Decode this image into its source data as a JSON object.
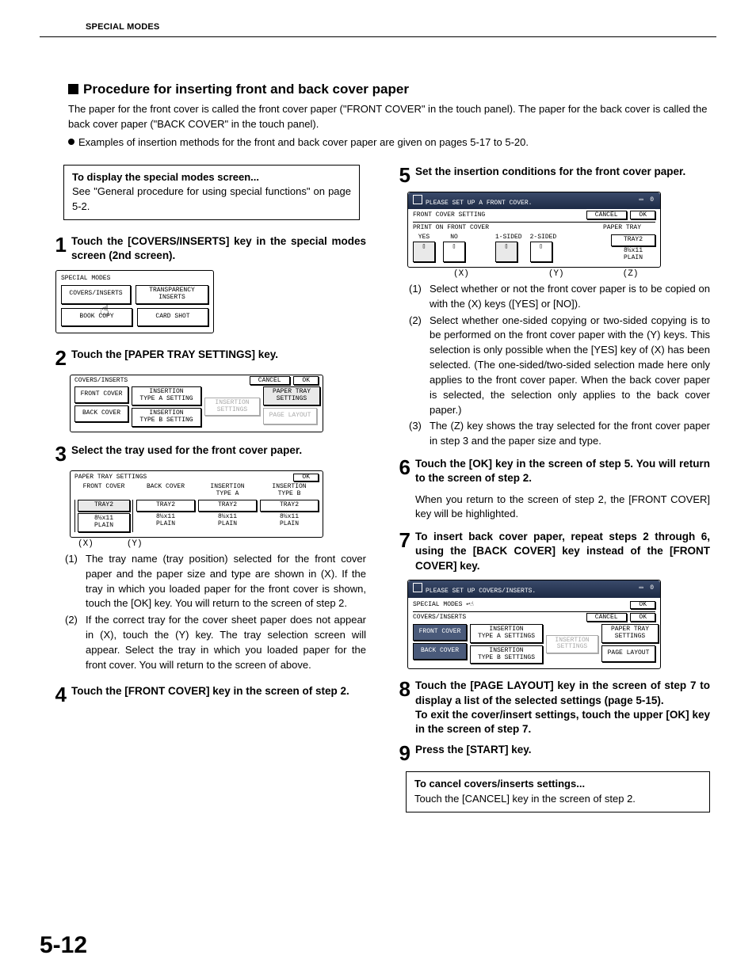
{
  "header": "SPECIAL MODES",
  "page_number": "5-12",
  "section_title": "Procedure for inserting front and back cover paper",
  "intro_p1": "The paper for the front cover is called the front cover paper (\"FRONT COVER\" in the touch panel). The paper for the back cover is called the back cover paper (\"BACK COVER\" in the touch panel).",
  "intro_bullet": "Examples of insertion methods for the front and back cover paper are given on pages 5-17 to 5-20.",
  "note1_title": "To display the special modes screen...",
  "note1_body": "See \"General procedure for using special functions\" on page 5-2.",
  "steps": {
    "s1": "Touch the [COVERS/INSERTS] key in the special modes screen (2nd screen).",
    "s2": "Touch the [PAPER TRAY SETTINGS] key.",
    "s3": "Select the tray used for the front cover paper.",
    "s4": "Touch the [FRONT COVER] key in the screen of step 2.",
    "s5": "Set the insertion conditions for the front cover paper.",
    "s6": "Touch the [OK] key in the screen of step 5. You will return to the screen of step 2.",
    "s7": "To insert back cover paper, repeat steps 2 through 6, using the [BACK COVER] key instead of the [FRONT COVER] key.",
    "s8": "Touch the [PAGE LAYOUT] key in the screen of step 7 to display a list of the selected settings (page 5-15).\nTo exit the cover/insert settings, touch the upper [OK] key in the screen of step 7.",
    "s9": "Press the [START] key."
  },
  "s3_p1": "The tray name (tray position) selected for the front cover paper and the paper size and type are shown in  (X).  If the tray in which  you loaded paper for the front cover is shown, touch the [OK] key. You will return to the screen of step 2.",
  "s3_p2": "If the correct tray for the cover sheet paper does not appear in  (X), touch the (Y) key. The tray selection screen will appear. Select the tray in which you loaded paper for the front cover. You will return to the screen of above.",
  "s5_p1": "Select whether or not the front cover paper is to be copied on with the (X) keys ([YES] or [NO]).",
  "s5_p2": "Select whether one-sided copying or two-sided copying is to be performed on the front cover paper with the (Y) keys. This selection is only possible when the [YES] key of (X) has been selected. (The one-sided/two-sided selection made here only applies to the front cover paper. When the back cover paper is selected, the selection only applies to the back cover paper.)",
  "s5_p3": "The (Z) key shows the tray selected for the front cover paper in step 3 and the paper size and type.",
  "s6_body": "When you return to the screen of step 2, the [FRONT COVER] key will be highlighted.",
  "cancel_title": "To cancel covers/inserts settings...",
  "cancel_body": "Touch the [CANCEL] key in the screen of step 2.",
  "mock1": {
    "title": "SPECIAL MODES",
    "b1": "COVERS/INSERTS",
    "b2": "TRANSPARENCY\nINSERTS",
    "b3": "BOOK COPY",
    "b4": "CARD SHOT"
  },
  "mock2": {
    "title": "COVERS/INSERTS",
    "cancel": "CANCEL",
    "ok": "OK",
    "front": "FRONT COVER",
    "back": "BACK COVER",
    "ia": "INSERTION\nTYPE A SETTING",
    "ib": "INSERTION\nTYPE B SETTING",
    "ins": "INSERTION\nSETTINGS",
    "pts": "PAPER TRAY\nSETTINGS",
    "pl": "PAGE LAYOUT"
  },
  "mock3": {
    "title": "PAPER TRAY SETTINGS",
    "ok": "OK",
    "cols": [
      "FRONT COVER",
      "BACK COVER",
      "INSERTION\nTYPE A",
      "INSERTION\nTYPE B"
    ],
    "tray": "TRAY2",
    "paper": "8½x11\nPLAIN",
    "x": "(X)",
    "y": "(Y)"
  },
  "mock5": {
    "bar": "PLEASE SET UP A FRONT COVER.",
    "sub": "FRONT COVER SETTING",
    "cancel": "CANCEL",
    "ok": "OK",
    "print": "PRINT ON FRONT COVER",
    "pt": "PAPER TRAY",
    "yes": "YES",
    "no": "NO",
    "s1": "1-SIDED",
    "s2": "2-SIDED",
    "tray": "TRAY2",
    "paper": "8½x11\nPLAIN",
    "x": "(X)",
    "y": "(Y)",
    "z": "(Z)"
  },
  "mock7": {
    "bar": "PLEASE SET UP COVERS/INSERTS.",
    "sm": "SPECIAL MODES",
    "ci": "COVERS/INSERTS",
    "ok": "OK",
    "cancel": "CANCEL",
    "front": "FRONT COVER",
    "back": "BACK COVER",
    "ia": "INSERTION\nTYPE A SETTINGS",
    "ib": "INSERTION\nTYPE B SETTINGS",
    "ins": "INSERTION\nSETTINGS",
    "pts": "PAPER TRAY\nSETTINGS",
    "pl": "PAGE LAYOUT"
  }
}
